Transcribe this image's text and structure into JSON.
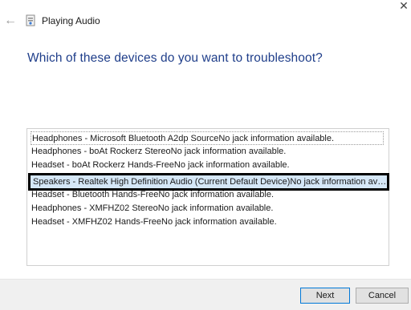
{
  "window": {
    "title": "Playing Audio",
    "close_glyph": "✕"
  },
  "header": {
    "back_icon": "back-arrow-icon",
    "app_icon": "audio-troubleshooter-icon"
  },
  "main": {
    "question": "Which of these devices do you want to troubleshoot?",
    "devices": [
      "Headphones - Microsoft Bluetooth A2dp SourceNo jack information available.",
      "Headphones - boAt Rockerz StereoNo jack information available.",
      "Headset - boAt Rockerz Hands-FreeNo jack information available.",
      "Speakers - Realtek High Definition Audio (Current Default Device)No jack information ava...",
      "Headset - Bluetooth Hands-FreeNo jack information available.",
      "Headphones - XMFHZ02 StereoNo jack information available.",
      "Headset - XMFHZ02 Hands-FreeNo jack information available."
    ],
    "selected_index": 3
  },
  "footer": {
    "next_label": "Next",
    "cancel_label": "Cancel"
  },
  "colors": {
    "question": "#1f3e8a",
    "selected_bg": "#d5e7f7",
    "footer_bg": "#f0f0f0"
  }
}
